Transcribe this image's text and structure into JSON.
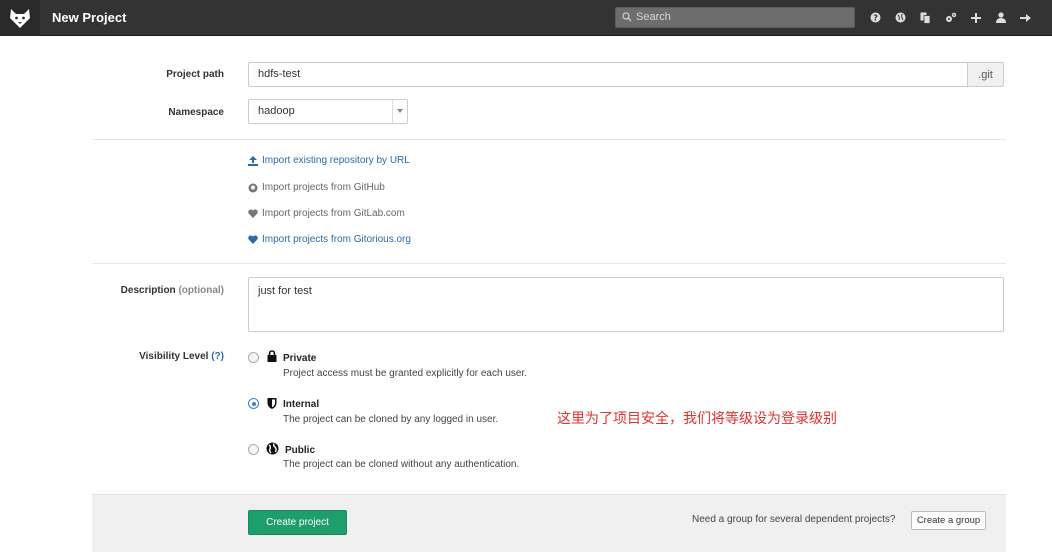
{
  "header": {
    "title": "New Project",
    "search_placeholder": "Search",
    "icons": [
      "help-icon",
      "globe-icon",
      "copy-icon",
      "cogs-icon",
      "plus-icon",
      "user-icon",
      "signout-icon"
    ]
  },
  "form": {
    "project_path_label": "Project path",
    "project_path_value": "hdfs-test",
    "project_path_suffix": ".git",
    "namespace_label": "Namespace",
    "namespace_value": "hadoop",
    "imports": [
      {
        "label": "Import existing repository by URL",
        "icon": "upload-icon"
      },
      {
        "label": "Import projects from GitHub",
        "icon": "github-icon"
      },
      {
        "label": "Import projects from GitLab.com",
        "icon": "heart-icon"
      },
      {
        "label": "Import projects from Gitorious.org",
        "icon": "heart-icon"
      }
    ],
    "description_label": "Description",
    "description_optional": "(optional)",
    "description_value": "just for test",
    "visibility_label": "Visibility Level",
    "visibility_help": "(?)",
    "visibility_options": [
      {
        "title": "Private",
        "desc": "Project access must be granted explicitly for each user.",
        "icon": "lock-icon",
        "checked": false
      },
      {
        "title": "Internal",
        "desc": "The project can be cloned by any logged in user.",
        "icon": "shield-icon",
        "checked": true
      },
      {
        "title": "Public",
        "desc": "The project can be cloned without any authentication.",
        "icon": "globe-icon",
        "checked": false
      }
    ]
  },
  "annotation": "这里为了项目安全，我们将等级设为登录级别",
  "footer": {
    "create_label": "Create project",
    "need_group_text": "Need a group for several dependent projects?",
    "create_group_label": "Create a group"
  },
  "colors": {
    "header_bg": "#333333",
    "primary_button": "#1e9d6d",
    "link": "#2a6ba8",
    "annotation": "#e0322e"
  }
}
